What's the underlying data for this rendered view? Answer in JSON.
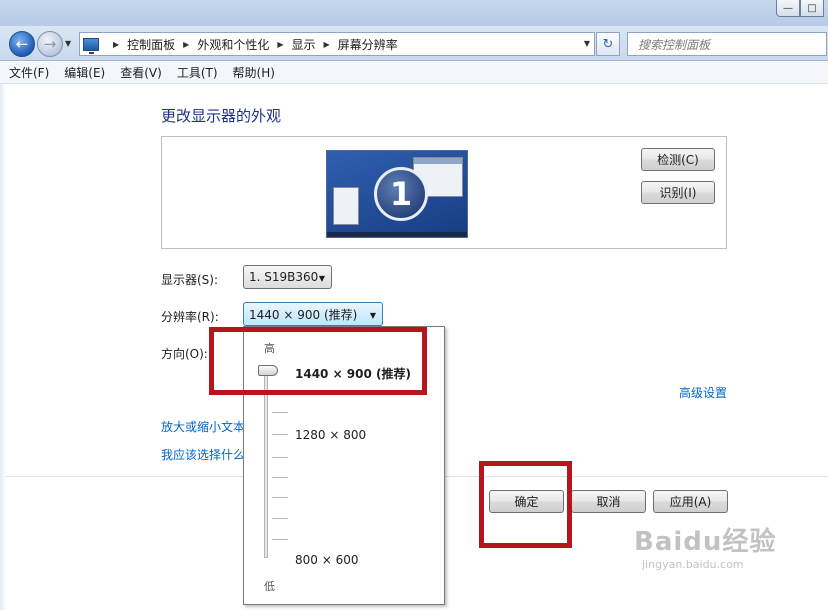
{
  "window": {
    "minimize_glyph": "—",
    "maximize_glyph": "□"
  },
  "nav": {
    "back_glyph": "←",
    "forward_glyph": "→",
    "dropdown_glyph": "▼",
    "refresh_glyph": "↻"
  },
  "address": {
    "breadcrumbs": [
      "控制面板",
      "外观和个性化",
      "显示",
      "屏幕分辨率"
    ],
    "separator": "▶",
    "dropdown_glyph": "▼"
  },
  "search": {
    "placeholder": "搜索控制面板"
  },
  "menu": [
    "文件(F)",
    "编辑(E)",
    "查看(V)",
    "工具(T)",
    "帮助(H)"
  ],
  "content": {
    "heading": "更改显示器的外观",
    "monitor_number": "1",
    "detect_button": "检测(C)",
    "identify_button": "识别(I)",
    "display_label": "显示器(S):",
    "display_value": "1. S19B360",
    "resolution_label": "分辨率(R):",
    "resolution_value": "1440 × 900 (推荐)",
    "orientation_label": "方向(O):",
    "advanced_link": "高级设置",
    "zoom_text_link": "放大或缩小文本",
    "which_link": "我应该选择什么",
    "combo_arrow": "▼"
  },
  "resolution_popup": {
    "high_label": "高",
    "low_label": "低",
    "selected_option": "1440 × 900 (推荐)",
    "middle_option": "1280 × 800",
    "min_option": "800 × 600"
  },
  "footer": {
    "ok": "确定",
    "cancel": "取消",
    "apply": "应用(A)"
  },
  "watermark": {
    "main": "Baidu经验",
    "sub": "jingyan.baidu.com"
  },
  "colors": {
    "accent": "#1e3287",
    "link": "#0066cc",
    "highlight": "#b5161b"
  }
}
